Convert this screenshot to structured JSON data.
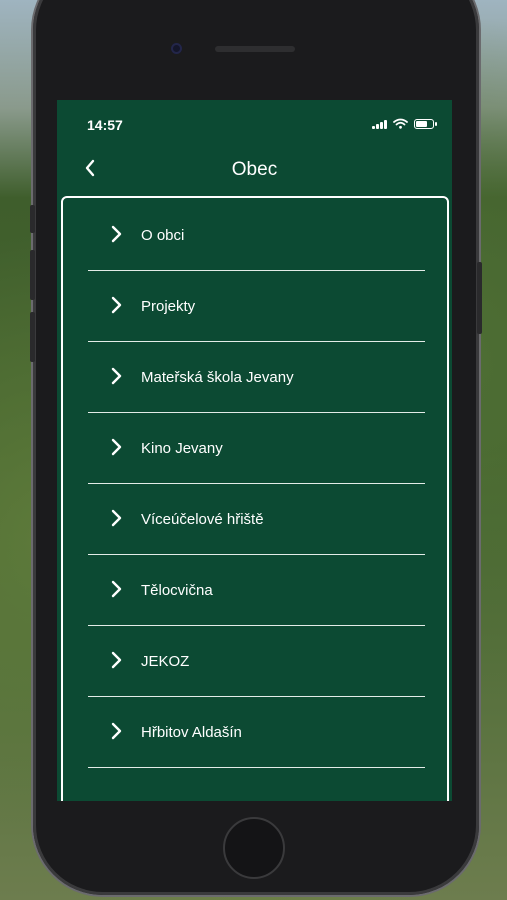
{
  "status_bar": {
    "time": "14:57",
    "battery_level": 0.75
  },
  "nav": {
    "title": "Obec",
    "back_icon": "chevron-left-icon"
  },
  "menu": {
    "items": [
      {
        "label": "O obci"
      },
      {
        "label": "Projekty"
      },
      {
        "label": "Mateřská škola Jevany"
      },
      {
        "label": "Kino Jevany"
      },
      {
        "label": "Víceúčelové hřiště"
      },
      {
        "label": "Tělocvična"
      },
      {
        "label": "JEKOZ"
      },
      {
        "label": "Hřbitov Aldašín"
      }
    ]
  },
  "colors": {
    "accent": "#0c4a33",
    "text": "#ffffff",
    "divider": "#e4ece8"
  }
}
